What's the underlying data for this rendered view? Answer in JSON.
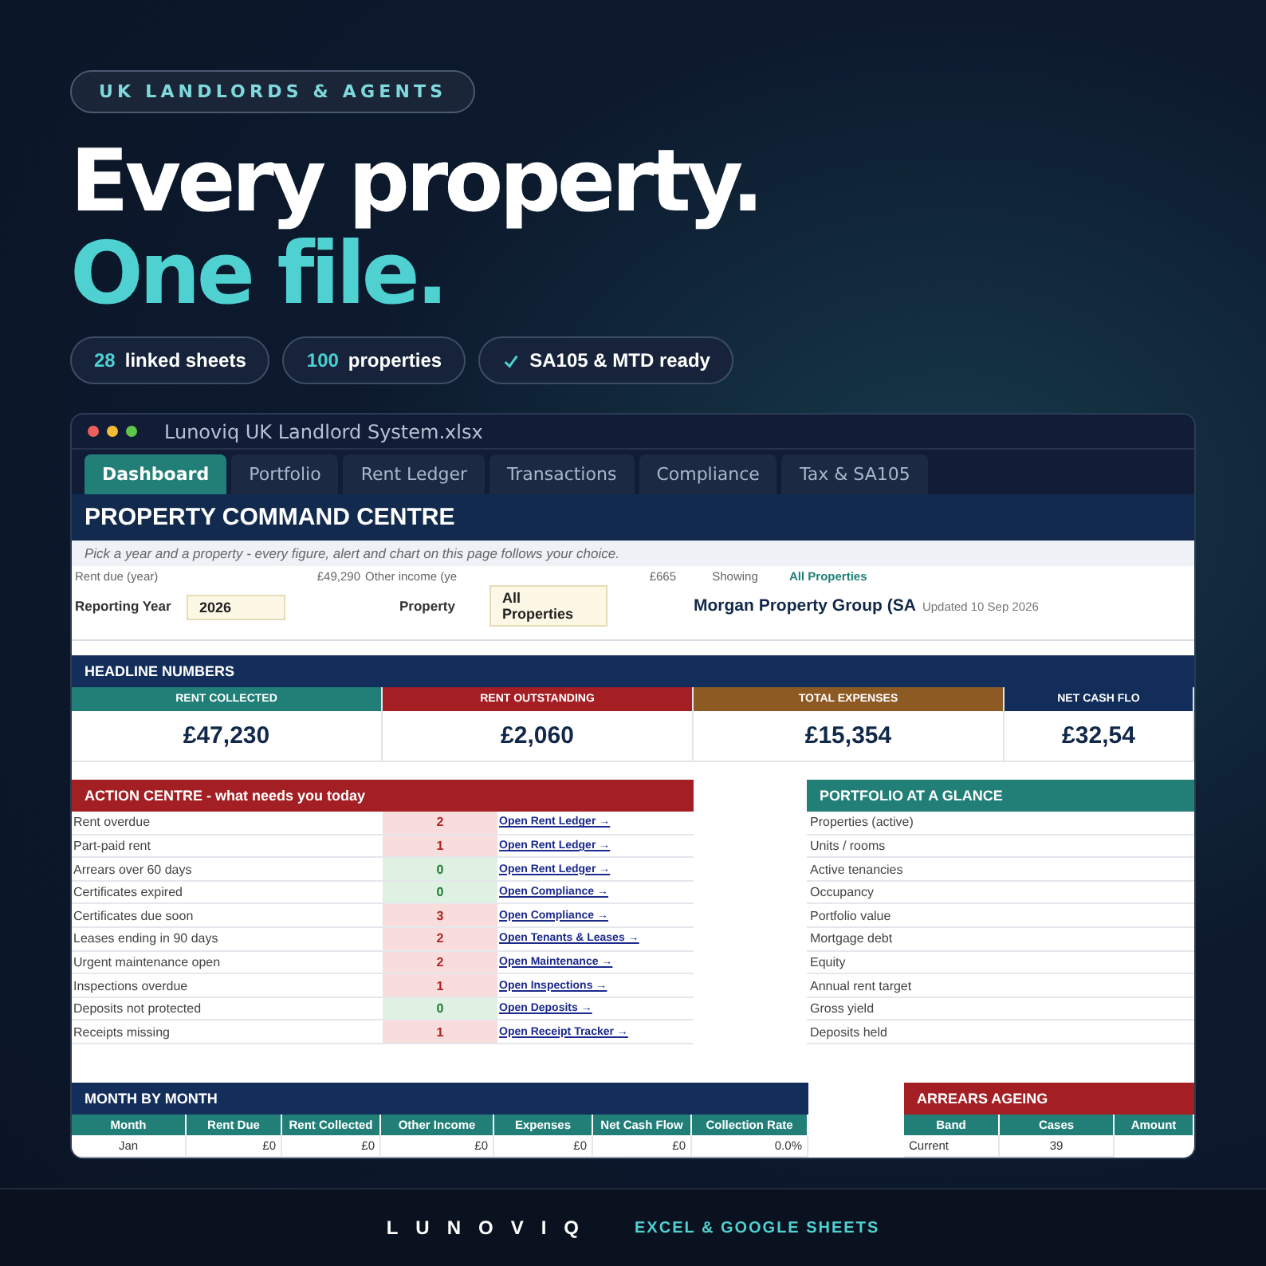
{
  "hero": {
    "badge": "UK LANDLORDS & AGENTS",
    "headline": "Every property.",
    "subheadline": "One file.",
    "pills": [
      {
        "kind": "count",
        "value": "28",
        "label": "linked sheets"
      },
      {
        "kind": "count",
        "value": "100",
        "label": "properties"
      },
      {
        "kind": "check",
        "label": "SA105 & MTD ready"
      }
    ]
  },
  "window": {
    "title": "Lunoviq UK Landlord System.xlsx",
    "tabs": [
      {
        "label": "Dashboard",
        "selected": true
      },
      {
        "label": "Portfolio",
        "selected": false
      },
      {
        "label": "Rent Ledger",
        "selected": false
      },
      {
        "label": "Transactions",
        "selected": false
      },
      {
        "label": "Compliance",
        "selected": false
      },
      {
        "label": "Tax & SA105",
        "selected": false
      }
    ]
  },
  "sheet": {
    "title": "PROPERTY COMMAND CENTRE",
    "hint": "Pick a year and a property - every figure, alert and chart on this page follows your choice.",
    "info": {
      "rent_due_label": "Rent due (year)",
      "rent_due": "£49,290",
      "other_income_label": "Other income (ye",
      "other_income": "£665",
      "showing_label": "Showing",
      "showing": "All Properties",
      "year_label": "Reporting Year",
      "year": "2026",
      "property_label": "Property",
      "property": "All Properties",
      "company": "Morgan Property Group (SA",
      "updated": "Updated 10 Sep 2026"
    },
    "headline": {
      "title": "HEADLINE NUMBERS",
      "cards": [
        {
          "label": "RENT COLLECTED",
          "value": "£47,230",
          "color": "#217f78"
        },
        {
          "label": "RENT OUTSTANDING",
          "value": "£2,060",
          "color": "#a31f24"
        },
        {
          "label": "TOTAL EXPENSES",
          "value": "£15,354",
          "color": "#8e5a24"
        },
        {
          "label": "NET CASH FLO",
          "value": "£32,54",
          "color": "#132d5a"
        }
      ]
    },
    "actions": {
      "title": "ACTION CENTRE - what needs you today",
      "rows": [
        {
          "label": "Rent overdue",
          "count": "2",
          "ok": false,
          "link": "Open Rent Ledger →"
        },
        {
          "label": "Part-paid rent",
          "count": "1",
          "ok": false,
          "link": "Open Rent Ledger →"
        },
        {
          "label": "Arrears over 60 days",
          "count": "0",
          "ok": true,
          "link": "Open Rent Ledger →"
        },
        {
          "label": "Certificates expired",
          "count": "0",
          "ok": true,
          "link": "Open Compliance →"
        },
        {
          "label": "Certificates due soon",
          "count": "3",
          "ok": false,
          "link": "Open Compliance →"
        },
        {
          "label": "Leases ending in 90 days",
          "count": "2",
          "ok": false,
          "link": "Open Tenants & Leases →"
        },
        {
          "label": "Urgent maintenance open",
          "count": "2",
          "ok": false,
          "link": "Open Maintenance →"
        },
        {
          "label": "Inspections overdue",
          "count": "1",
          "ok": false,
          "link": "Open Inspections →"
        },
        {
          "label": "Deposits not protected",
          "count": "0",
          "ok": true,
          "link": "Open Deposits →"
        },
        {
          "label": "Receipts missing",
          "count": "1",
          "ok": false,
          "link": "Open Receipt Tracker →"
        }
      ]
    },
    "portfolio": {
      "title": "PORTFOLIO AT A GLANCE",
      "rows": [
        "Properties (active)",
        "Units / rooms",
        "Active tenancies",
        "Occupancy",
        "Portfolio value",
        "Mortgage debt",
        "Equity",
        "Annual rent target",
        "Gross yield",
        "Deposits held"
      ]
    },
    "months": {
      "title": "MONTH BY MONTH",
      "columns": [
        "Month",
        "Rent Due",
        "Rent Collected",
        "Other Income",
        "Expenses",
        "Net Cash Flow",
        "Collection Rate"
      ],
      "rows": [
        [
          "Jan",
          "£0",
          "£0",
          "£0",
          "£0",
          "£0",
          "0.0%"
        ]
      ]
    },
    "arrears": {
      "title": "ARREARS AGEING",
      "columns": [
        "Band",
        "Cases",
        "Amount"
      ],
      "rows": [
        [
          "Current",
          "39"
        ]
      ]
    }
  },
  "footer": {
    "brand": "LUNOVIQ",
    "tagline": "EXCEL & GOOGLE SHEETS"
  }
}
